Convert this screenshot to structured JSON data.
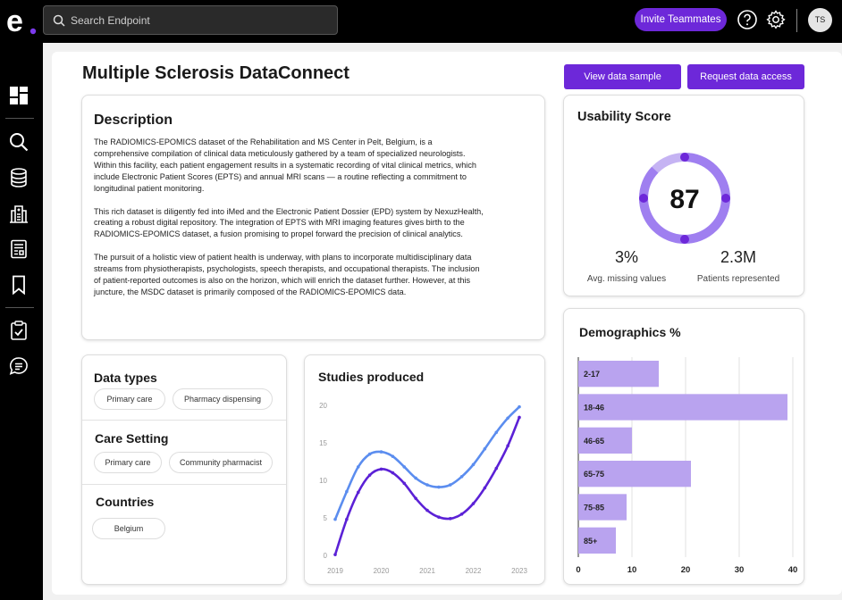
{
  "header": {
    "search_placeholder": "Search Endpoint",
    "invite_label": "Invite Teammates",
    "avatar_initials": "TS"
  },
  "sidebar": {
    "items": [
      "dashboard-icon",
      "search-icon",
      "database-icon",
      "hospital-icon",
      "report-icon",
      "bookmark-icon",
      "clipboard-check-icon",
      "chat-icon"
    ]
  },
  "page": {
    "title": "Multiple Sclerosis DataConnect",
    "view_sample_label": "View data sample",
    "request_access_label": "Request data access"
  },
  "description": {
    "heading": "Description",
    "paragraphs": [
      "The RADIOMICS-EPOMICS dataset of the Rehabilitation and MS Center in Pelt, Belgium, is a comprehensive compilation of clinical data meticulously gathered by a team of specialized neurologists. Within this facility, each patient engagement results in a systematic recording of vital clinical metrics, which include Electronic Patient Scores (EPTS) and annual MRI scans — a routine reflecting a commitment to longitudinal patient monitoring.",
      "This rich dataset is diligently fed into iMed and the Electronic Patient Dossier (EPD) system by NexuzHealth, creating a robust digital repository. The integration of EPTS with MRI imaging features gives birth to the RADIOMICS-EPOMICS dataset, a fusion promising to propel forward the precision of clinical analytics.",
      "The pursuit of a holistic view of patient health is underway, with plans to incorporate multidisciplinary data streams from physiotherapists, psychologists, speech therapists, and occupational therapists. The inclusion of patient-reported outcomes is also on the horizon, which will enrich the dataset further. However, at this juncture, the MSDC dataset is primarily composed of the RADIOMICS-EPOMICS data."
    ]
  },
  "usability": {
    "heading": "Usability Score",
    "score": "87",
    "score_fraction": 0.87,
    "missing_value": "3%",
    "missing_label": "Avg. missing values",
    "patients_value": "2.3M",
    "patients_label": "Patients represented"
  },
  "data_types": {
    "heading": "Data types",
    "chips": [
      "Primary care",
      "Pharmacy dispensing"
    ]
  },
  "care_setting": {
    "heading": "Care Setting",
    "chips": [
      "Primary care",
      "Community pharmacist"
    ]
  },
  "countries": {
    "heading": "Countries",
    "chips": [
      "Belgium"
    ]
  },
  "colors": {
    "accent": "#6d28d9",
    "accent_light": "#b9a3ef",
    "line_blue": "#5b8def",
    "line_purple": "#5b21d6"
  },
  "chart_data": [
    {
      "type": "line",
      "title": "Studies produced",
      "x": [
        2019,
        2019.25,
        2019.5,
        2019.75,
        2020,
        2020.25,
        2020.5,
        2020.75,
        2021,
        2021.25,
        2021.5,
        2021.75,
        2022,
        2022.25,
        2022.5,
        2022.75,
        2023
      ],
      "xticks": [
        "2019",
        "2020",
        "2021",
        "2022",
        "2023"
      ],
      "yticks": [
        "0",
        "5",
        "10",
        "15",
        "20"
      ],
      "ylim": [
        0,
        20
      ],
      "series": [
        {
          "name": "",
          "values": [
            4.8,
            8.5,
            11.8,
            13.5,
            13.8,
            13.2,
            11.8,
            10.3,
            9.4,
            9.1,
            9.4,
            10.5,
            12.1,
            14.2,
            16.4,
            18.3,
            19.8
          ]
        },
        {
          "name": "",
          "values": [
            0.1,
            4.8,
            8.4,
            10.7,
            11.5,
            11.0,
            9.6,
            7.6,
            6.0,
            5.1,
            4.9,
            5.5,
            6.9,
            9.0,
            11.6,
            14.6,
            18.4
          ]
        }
      ]
    },
    {
      "type": "bar",
      "orientation": "horizontal",
      "title": "Demographics %",
      "categories": [
        "2-17",
        "18-46",
        "46-65",
        "65-75",
        "75-85",
        "85+"
      ],
      "values": [
        15,
        39,
        10,
        21,
        9,
        7
      ],
      "xticks": [
        "0",
        "10",
        "20",
        "30",
        "40"
      ],
      "xlim": [
        0,
        40
      ],
      "grid": true
    }
  ]
}
